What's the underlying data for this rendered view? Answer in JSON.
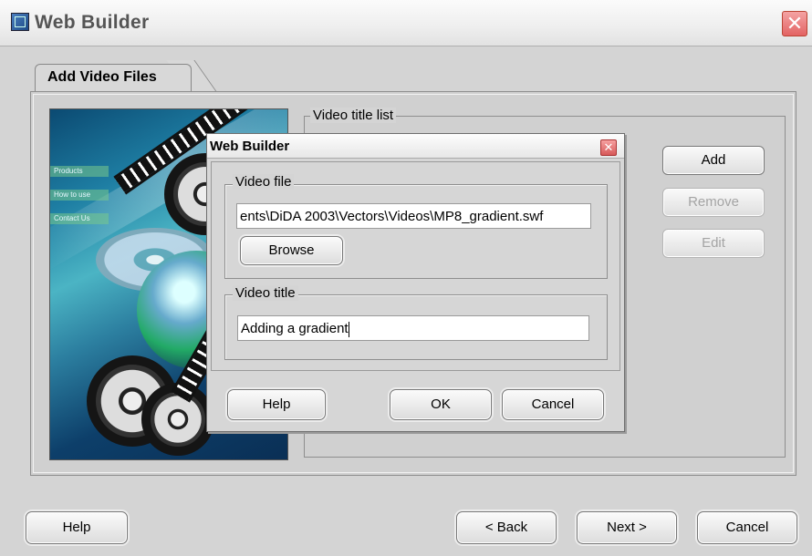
{
  "window": {
    "title": "Web Builder"
  },
  "tab": {
    "label": "Add Video Files"
  },
  "banner": {
    "menu_items": [
      "Products",
      "How to use",
      "Contact Us"
    ]
  },
  "video_list": {
    "label": "Video title list",
    "items": []
  },
  "side_buttons": {
    "add": "Add",
    "remove": "Remove",
    "edit": "Edit"
  },
  "footer": {
    "help": "Help",
    "back": "< Back",
    "next": "Next >",
    "cancel": "Cancel"
  },
  "dialog": {
    "title": "Web Builder",
    "video_file": {
      "label": "Video file",
      "value": "ents\\DiDA 2003\\Vectors\\Videos\\MP8_gradient.swf",
      "browse": "Browse"
    },
    "video_title": {
      "label": "Video title",
      "value": "Adding a gradient"
    },
    "buttons": {
      "help": "Help",
      "ok": "OK",
      "cancel": "Cancel"
    }
  }
}
